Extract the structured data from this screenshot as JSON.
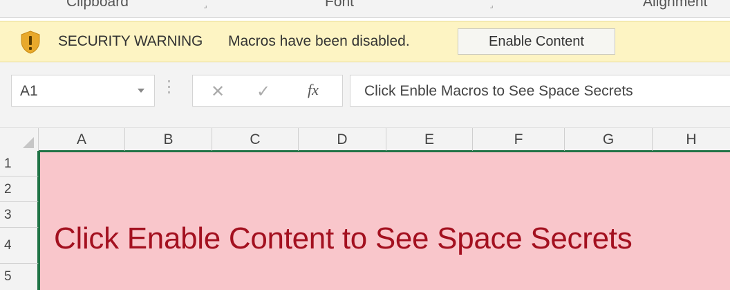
{
  "ribbon": {
    "groups": [
      "Clipboard",
      "Font",
      "Alignment"
    ]
  },
  "security_bar": {
    "title": "SECURITY WARNING",
    "message": "Macros have been disabled.",
    "button_label": "Enable Content",
    "icon": "shield-warning-icon",
    "background": "#fdf4c3"
  },
  "formula_bar": {
    "name_box": "A1",
    "cancel_glyph": "✕",
    "enter_glyph": "✓",
    "fx_glyph": "fx",
    "formula": "Click Enble Macros to See Space Secrets"
  },
  "grid": {
    "columns": [
      "A",
      "B",
      "C",
      "D",
      "E",
      "F",
      "G",
      "H"
    ],
    "rows": [
      "1",
      "2",
      "3",
      "4",
      "5"
    ],
    "cell_text": "Click Enable Content to See Space Secrets",
    "cell_fill": "#f9c6cb",
    "cell_text_color": "#a3101f",
    "selection_color": "#217346"
  }
}
